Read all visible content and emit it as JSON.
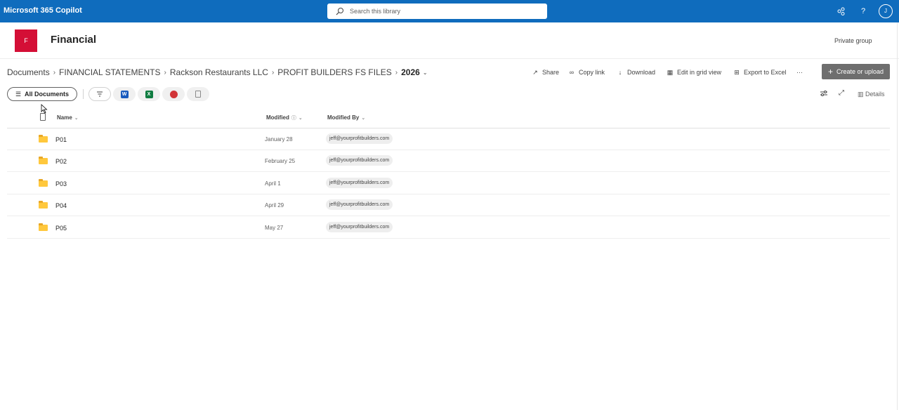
{
  "topbar": {
    "app_title": "Microsoft 365 Copilot",
    "search_placeholder": "Search this library",
    "icons": [
      "share-network-icon",
      "help-icon"
    ],
    "help_glyph": "?",
    "user_initial": "J",
    "bg_color": "#0f6cbd"
  },
  "site": {
    "logo_letter": "F",
    "logo_color": "#d40f36",
    "title": "Financial",
    "group_label": "Private group"
  },
  "breadcrumb": {
    "items": [
      "Documents",
      "FINANCIAL STATEMENTS",
      "Rackson Restaurants LLC",
      "PROFIT BUILDERS FS FILES"
    ],
    "current": "2026"
  },
  "commands": {
    "share": "Share",
    "copy_link": "Copy link",
    "download": "Download",
    "edit_grid": "Edit in grid view",
    "export_excel": "Export to Excel",
    "more": "···",
    "create_upload": "Create or upload"
  },
  "views": {
    "current_view": "All Documents",
    "details": "Details"
  },
  "list": {
    "columns": {
      "name": "Name",
      "modified": "Modified",
      "modified_by": "Modified By"
    },
    "rows": [
      {
        "name": "P01",
        "modified": "January 28",
        "modified_by": "jeff@yourprofitbuilders.com"
      },
      {
        "name": "P02",
        "modified": "February 25",
        "modified_by": "jeff@yourprofitbuilders.com"
      },
      {
        "name": "P03",
        "modified": "April 1",
        "modified_by": "jeff@yourprofitbuilders.com"
      },
      {
        "name": "P04",
        "modified": "April 29",
        "modified_by": "jeff@yourprofitbuilders.com"
      },
      {
        "name": "P05",
        "modified": "May 27",
        "modified_by": "jeff@yourprofitbuilders.com"
      }
    ]
  }
}
